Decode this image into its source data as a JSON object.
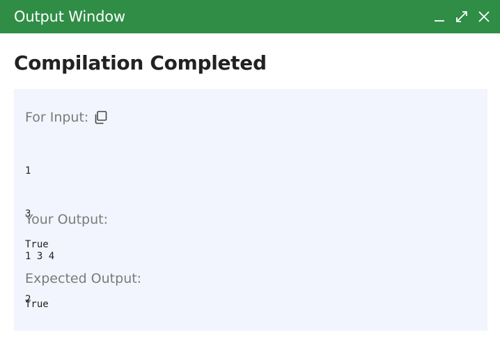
{
  "window": {
    "title": "Output Window",
    "icons": [
      "minimize-icon",
      "maximize-icon",
      "close-icon"
    ]
  },
  "main": {
    "heading": "Compilation Completed"
  },
  "sections": {
    "input_label": "For Input:",
    "input_lines": [
      "1",
      "3",
      "1 3 4",
      "2"
    ],
    "your_output_label": "Your Output:",
    "your_output_value": "True",
    "expected_output_label": "Expected Output:",
    "expected_output_value": "True"
  },
  "colors": {
    "titlebar": "#2f8d46",
    "panel": "#f2f5fd",
    "label": "#7a7a7a"
  }
}
